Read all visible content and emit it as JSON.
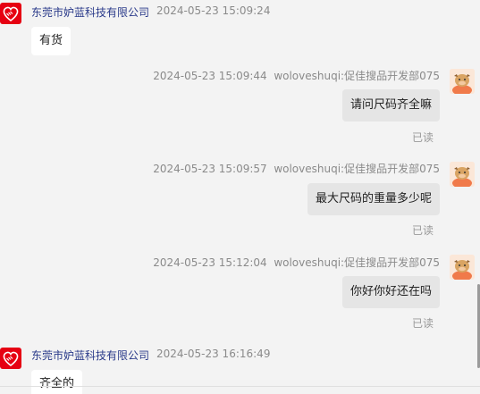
{
  "messages": [
    {
      "side": "left",
      "sender": "东莞市妒蓝科技有限公司",
      "time": "2024-05-23 15:09:24",
      "text": "有货"
    },
    {
      "side": "right",
      "sender": "woloveshuqi:促佳搜品开发部075",
      "time": "2024-05-23 15:09:44",
      "text": "请问尺码齐全嘛",
      "status": "已读"
    },
    {
      "side": "right",
      "sender": "woloveshuqi:促佳搜品开发部075",
      "time": "2024-05-23 15:09:57",
      "text": "最大尺码的重量多少呢",
      "status": "已读"
    },
    {
      "side": "right",
      "sender": "woloveshuqi:促佳搜品开发部075",
      "time": "2024-05-23 15:12:04",
      "text": "你好你好还在吗",
      "status": "已读"
    },
    {
      "side": "left",
      "sender": "东莞市妒蓝科技有限公司",
      "time": "2024-05-23 16:16:49",
      "text": "齐全的"
    }
  ],
  "colors": {
    "background": "#f3f3f3",
    "seller_avatar": "#e60012",
    "seller_name": "#2a3a8a",
    "left_bubble": "#ffffff",
    "right_bubble": "#e5e5e5"
  },
  "icons": {
    "seller_avatar": "heart-handshake-logo-icon",
    "buyer_avatar": "cartoon-cow-avatar-icon"
  }
}
